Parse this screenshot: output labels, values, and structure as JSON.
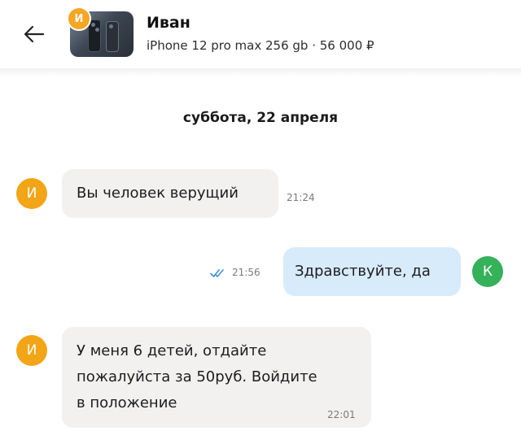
{
  "header": {
    "back_icon": "arrow-left-icon",
    "contact_initial": "И",
    "contact_name": "Иван",
    "listing": "iPhone 12 pro max 256 gb · 56 000 ₽"
  },
  "date_separator": "суббота, 22 апреля",
  "messages": [
    {
      "sender_initial": "И",
      "lines": [
        "Вы человек верущий"
      ],
      "time": "21:24",
      "direction": "incoming"
    },
    {
      "sender_initial": "К",
      "lines": [
        "Здравствуйте, да"
      ],
      "time": "21:56",
      "direction": "outgoing",
      "status_icon": "double-check-icon"
    },
    {
      "sender_initial": "И",
      "lines": [
        "У меня 6 детей, отдайте",
        "пожалуйста за 50руб. Войдите",
        "в положение"
      ],
      "time": "22:01",
      "direction": "incoming"
    }
  ],
  "colors": {
    "incoming_bubble": "#f2f1f0",
    "outgoing_bubble": "#d7ebfb",
    "avatar_orange": "#f2a516",
    "avatar_green": "#35b15a",
    "read_check": "#3b8fd9"
  }
}
